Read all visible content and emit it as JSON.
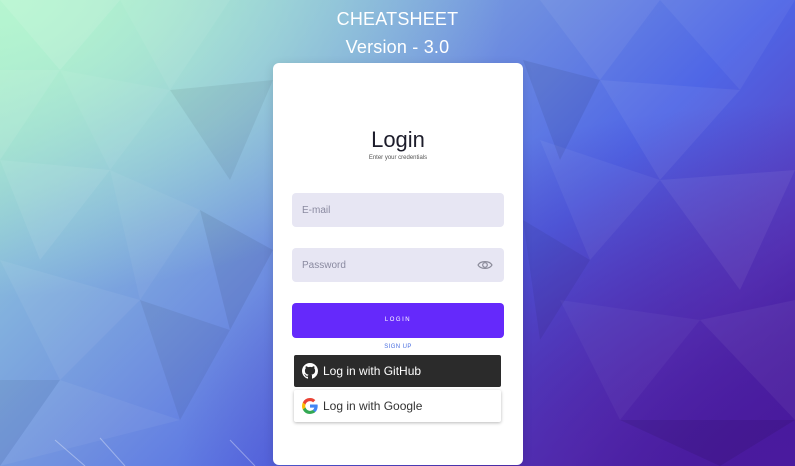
{
  "app": {
    "title": "CHEATSHEET",
    "version": "Version - 3.0"
  },
  "login": {
    "title": "Login",
    "subtitle": "Enter your credentials",
    "email_placeholder": "E-mail",
    "password_placeholder": "Password",
    "submit_label": "LOGIN",
    "signup_label": "SIGN UP"
  },
  "social": {
    "github_label": "Log in with GitHub",
    "google_label": "Log in with Google"
  },
  "colors": {
    "accent": "#6529fb",
    "field_bg": "#e7e6f3",
    "github_bg": "#2b2b2b",
    "link": "#4a6fe0"
  },
  "icons": {
    "password_toggle": "eye-icon",
    "github": "github-icon",
    "google": "google-icon"
  }
}
